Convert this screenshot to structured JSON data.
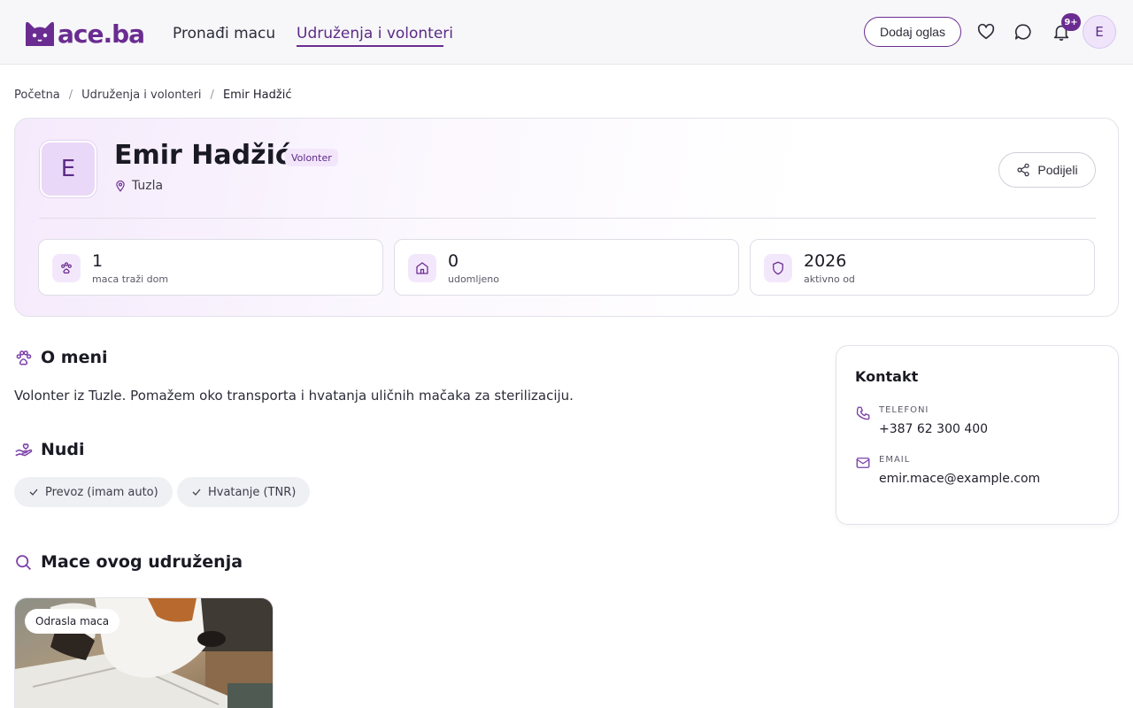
{
  "header": {
    "logo_text": "ace.ba",
    "nav": [
      {
        "label": "Pronađi macu"
      },
      {
        "label": "Udruženja i volonteri",
        "active": true
      }
    ],
    "add_listing_label": "Dodaj oglas",
    "notifications_badge": "9+",
    "user_initial": "E",
    "icons": [
      "heart-icon",
      "chat-icon",
      "bell-icon"
    ],
    "brand_color": "#6a2c91"
  },
  "breadcrumb": {
    "items": [
      "Početna",
      "Udruženja i volonteri",
      "Emir Hadžić"
    ],
    "separator": "/"
  },
  "profile": {
    "initial": "E",
    "name": "Emir Hadžić",
    "role": "Volonter",
    "location": "Tuzla",
    "share_label": "Podijeli",
    "stats": [
      {
        "value": "1",
        "label": "maca traži dom",
        "icon": "paw-icon"
      },
      {
        "value": "0",
        "label": "udomljeno",
        "icon": "home-icon"
      },
      {
        "value": "2026",
        "label": "aktivno od",
        "icon": "shield-icon"
      }
    ]
  },
  "about": {
    "title": "O meni",
    "text": "Volonter iz Tuzle. Pomažem oko transporta i hvatanja uličnih mačaka za sterilizaciju."
  },
  "offers": {
    "title": "Nudi",
    "items": [
      "Prevoz (imam auto)",
      "Hvatanje (TNR)"
    ]
  },
  "cats": {
    "title": "Mace ovog udruženja",
    "cards": [
      {
        "badge": "Odrasla maca"
      }
    ]
  },
  "contact": {
    "title": "Kontakt",
    "phone_label": "TELEFONI",
    "phone_value": "+387 62 300 400",
    "email_label": "EMAIL",
    "email_value": "emir.mace@example.com"
  }
}
